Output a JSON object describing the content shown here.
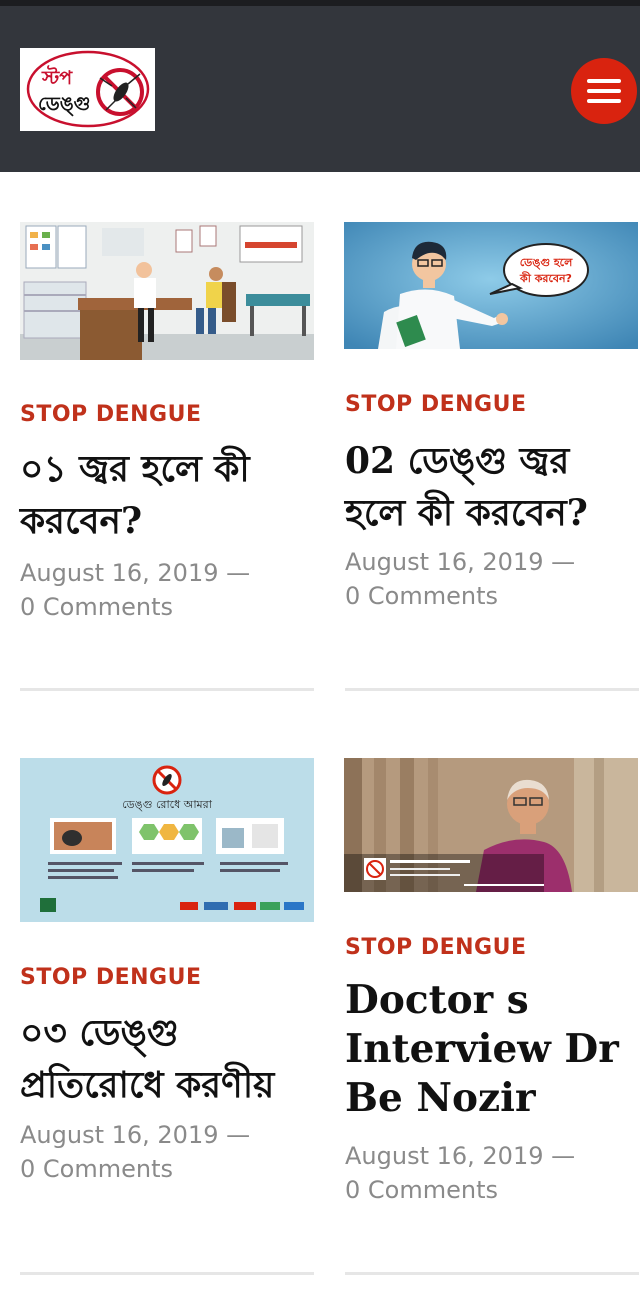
{
  "header": {
    "logo_line1": "স্টপ",
    "logo_line2": "ডেঙ্গু",
    "menu_icon": "hamburger-icon",
    "brand_color": "#d9230f",
    "header_bg": "#33363c"
  },
  "posts": [
    {
      "category": "STOP DENGUE",
      "title": "০১ জ্বর হলে কী করবেন?",
      "date": "August 16, 2019",
      "dash": "—",
      "comments": "0 Comments"
    },
    {
      "category": "STOP DENGUE",
      "title": "02 ডেঙ্গু জ্বর হলে কী করবেন?",
      "date": "August 16, 2019",
      "dash": "—",
      "comments": "0 Comments",
      "bubble_text_1": "ডেঙ্গু হলে",
      "bubble_text_2": "কী করবেন?"
    },
    {
      "category": "STOP DENGUE",
      "title": "০৩ ডেঙ্গু প্রতিরোধে করণীয়",
      "date": "August 16, 2019",
      "dash": "—",
      "comments": "0 Comments",
      "banner_text": "ডেঙ্গু রোধে আমরা"
    },
    {
      "category": "STOP DENGUE",
      "title": "Doctor s Interview Dr Be Nozir",
      "date": "August 16, 2019",
      "dash": "—",
      "comments": "0 Comments"
    }
  ]
}
